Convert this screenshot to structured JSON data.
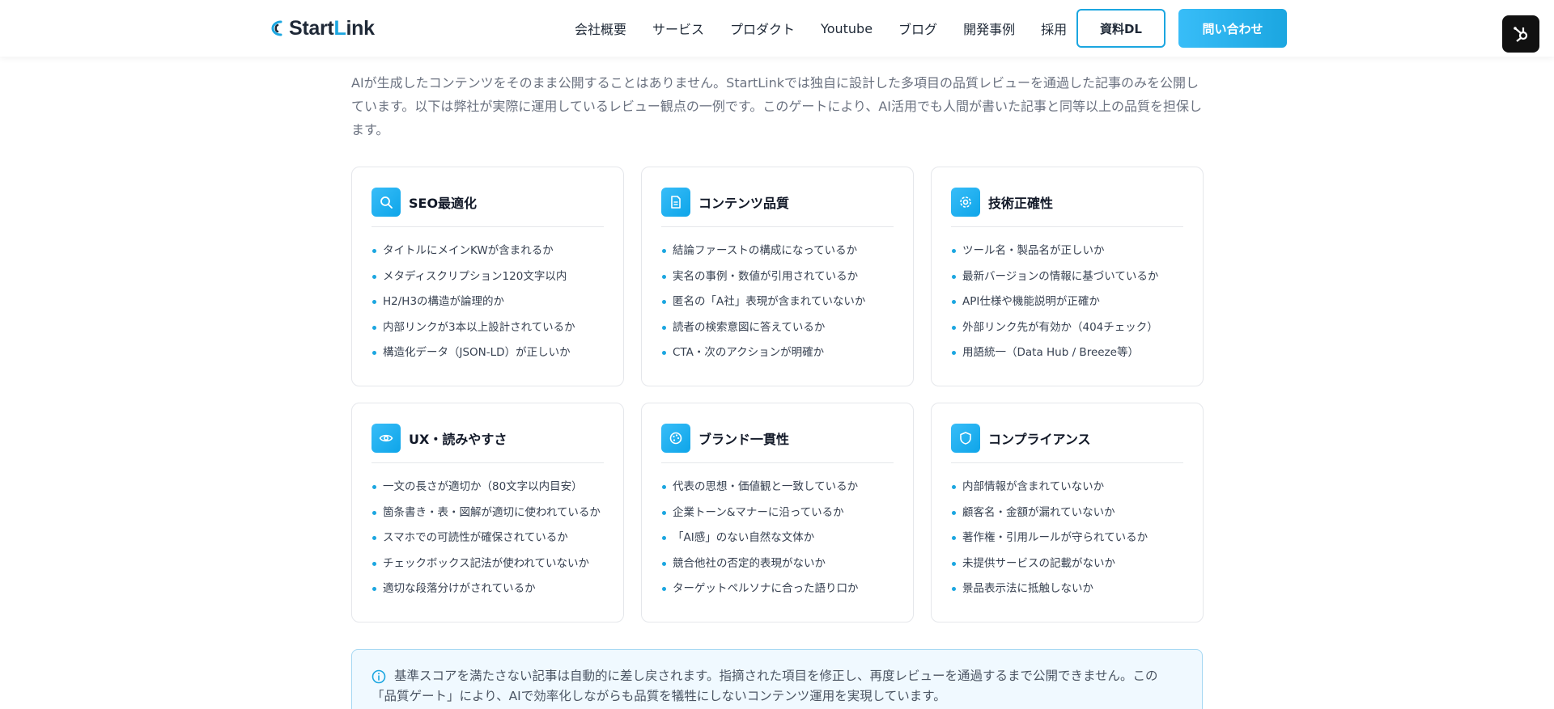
{
  "header": {
    "logo": {
      "prefix": "Start",
      "accent": "L",
      "suffix": "ink"
    },
    "nav": [
      "会社概要",
      "サービス",
      "プロダクト",
      "Youtube",
      "ブログ",
      "開発事例",
      "採用"
    ],
    "download_label": "資料DL",
    "contact_label": "問い合わせ"
  },
  "intro": "AIが生成したコンテンツをそのまま公開することはありません。StartLinkでは独自に設計した多項目の品質レビューを通過した記事のみを公開しています。以下は弊社が実際に運用しているレビュー観点の一例です。このゲートにより、AI活用でも人間が書いた記事と同等以上の品質を担保します。",
  "cards": [
    {
      "icon": "search-icon",
      "title": "SEO最適化",
      "items": [
        "タイトルにメインKWが含まれるか",
        "メタディスクリプション120文字以内",
        "H2/H3の構造が論理的か",
        "内部リンクが3本以上設計されているか",
        "構造化データ（JSON-LD）が正しいか"
      ]
    },
    {
      "icon": "document-icon",
      "title": "コンテンツ品質",
      "items": [
        "結論ファーストの構成になっているか",
        "実名の事例・数値が引用されているか",
        "匿名の「A社」表現が含まれていないか",
        "読者の検索意図に答えているか",
        "CTA・次のアクションが明確か"
      ]
    },
    {
      "icon": "gear-icon",
      "title": "技術正確性",
      "items": [
        "ツール名・製品名が正しいか",
        "最新バージョンの情報に基づいているか",
        "API仕様や機能説明が正確か",
        "外部リンク先が有効か（404チェック）",
        "用語統一（Data Hub / Breeze等）"
      ]
    },
    {
      "icon": "eye-icon",
      "title": "UX・読みやすさ",
      "items": [
        "一文の長さが適切か（80文字以内目安）",
        "箇条書き・表・図解が適切に使われているか",
        "スマホでの可読性が確保されているか",
        "チェックボックス記法が使われていないか",
        "適切な段落分けがされているか"
      ]
    },
    {
      "icon": "palette-icon",
      "title": "ブランド一貫性",
      "items": [
        "代表の思想・価値観と一致しているか",
        "企業トーン&マナーに沿っているか",
        "「AI感」のない自然な文体か",
        "競合他社の否定的表現がないか",
        "ターゲットペルソナに合った語り口か"
      ]
    },
    {
      "icon": "shield-icon",
      "title": "コンプライアンス",
      "items": [
        "内部情報が含まれていないか",
        "顧客名・金額が漏れていないか",
        "著作権・引用ルールが守られているか",
        "未提供サービスの記載がないか",
        "景品表示法に抵触しないか"
      ]
    }
  ],
  "notice": "基準スコアを満たさない記事は自動的に差し戻されます。指摘された項目を修正し、再度レビューを通過するまで公開できません。この「品質ゲート」により、AIで効率化しながらも品質を犠牲にしないコンテンツ運用を実現しています。",
  "colors": {
    "accent": "#1ba6e0",
    "text": "#1f2937",
    "muted": "#6b7280"
  }
}
